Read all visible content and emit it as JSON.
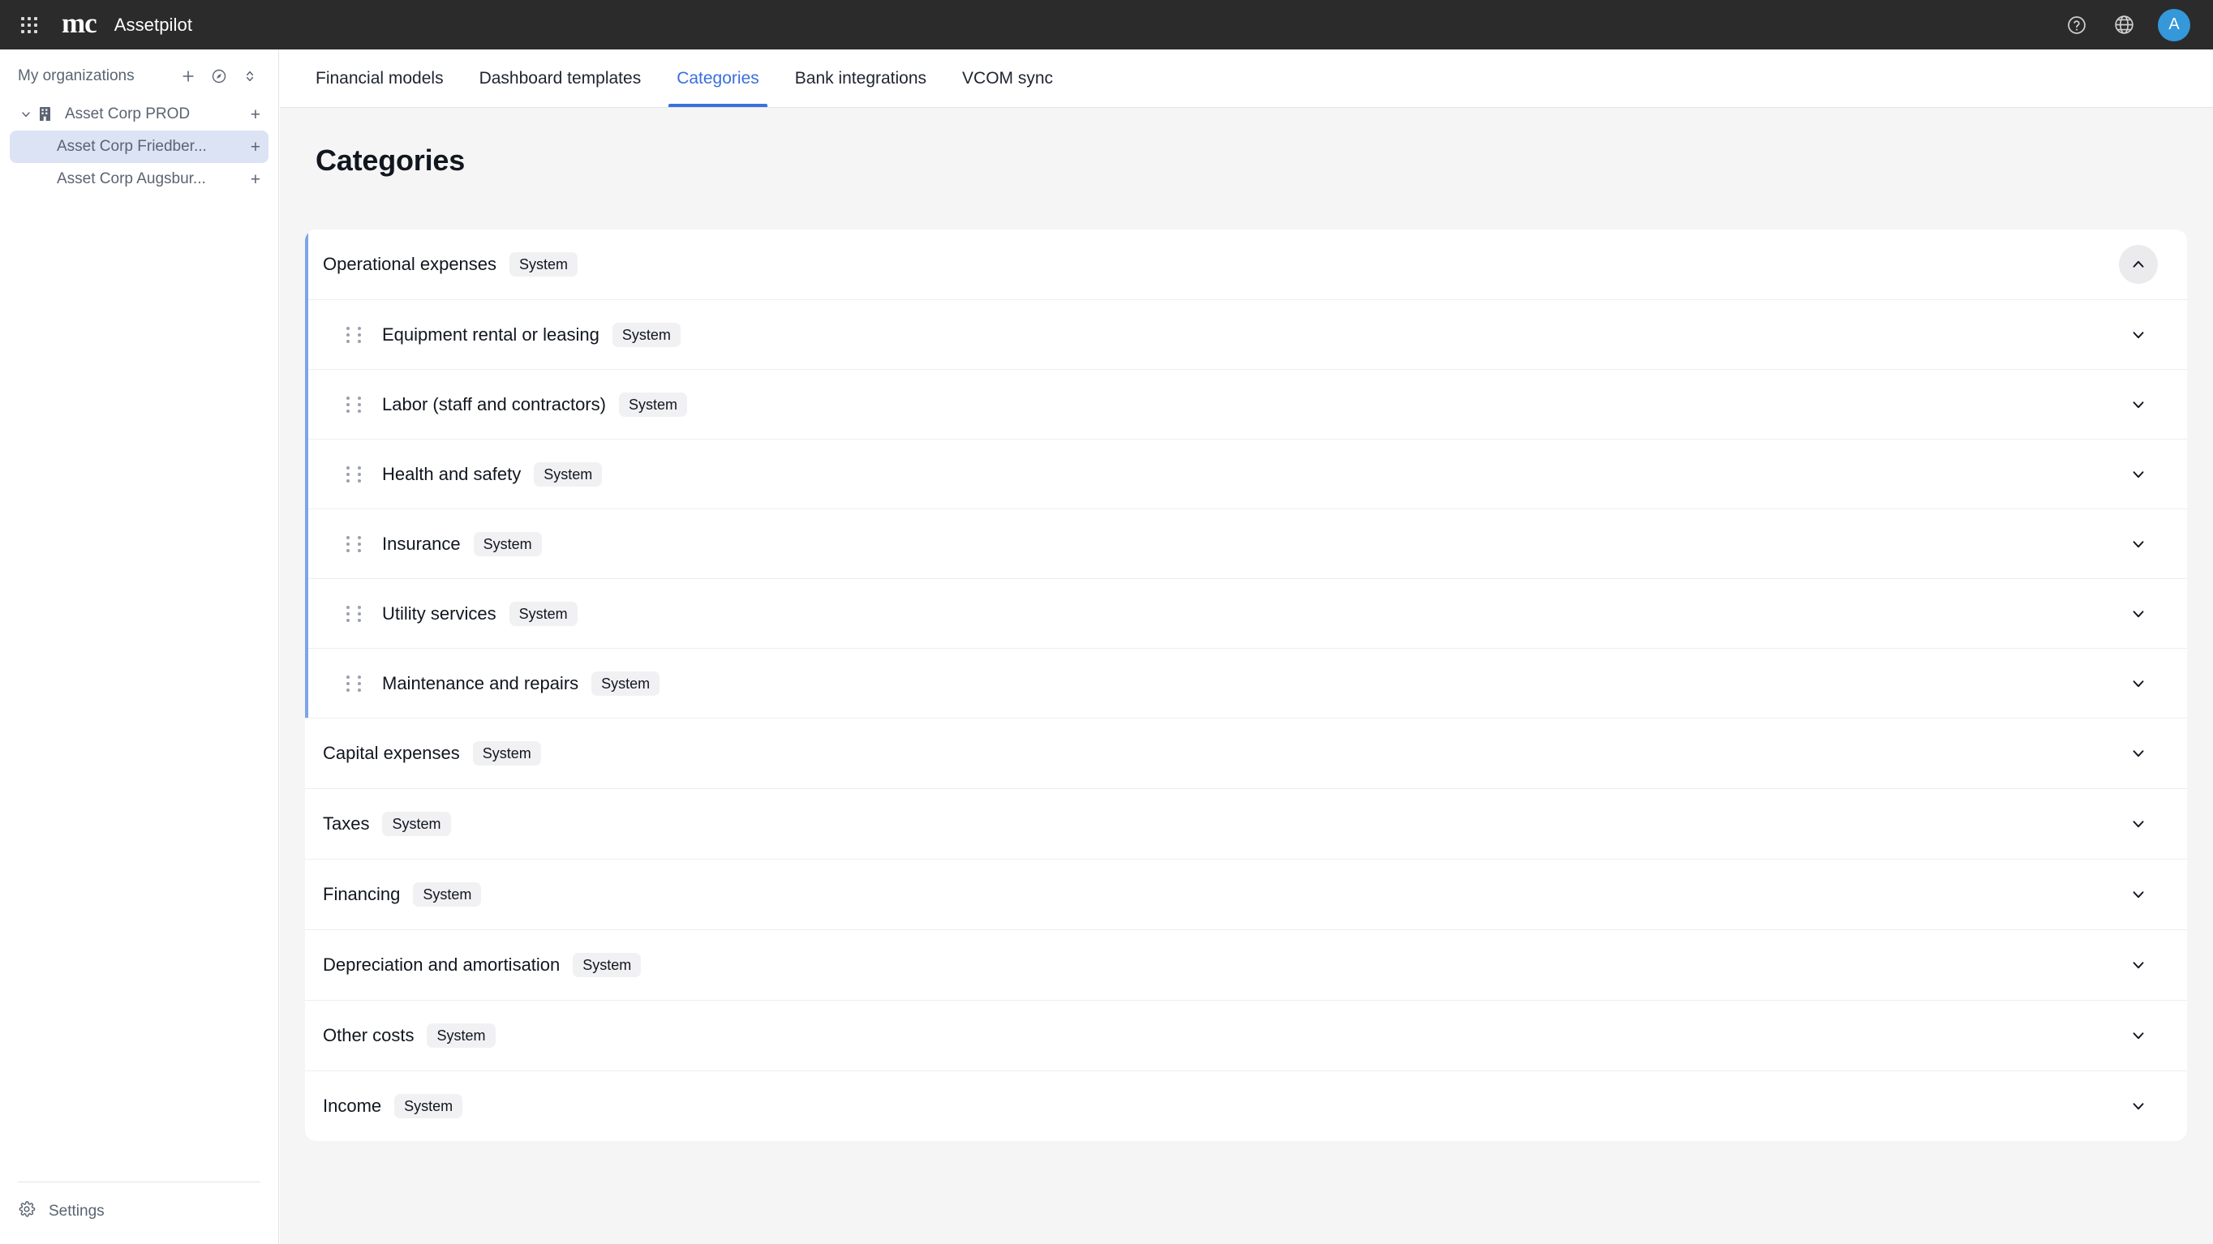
{
  "topbar": {
    "apps_icon": "apps-grid-icon",
    "logo_text": "mc",
    "brand": "Assetpilot",
    "help_icon": "help-circle-icon",
    "language_icon": "globe-icon",
    "avatar_initial": "A"
  },
  "sidebar": {
    "header": "My organizations",
    "add_icon": "plus-icon",
    "compass_icon": "compass-icon",
    "sort_icon": "chevron-up-down-icon",
    "items": [
      {
        "label": "Asset Corp PROD",
        "level": 0,
        "selected": false,
        "expanded": true,
        "has_building_icon": true,
        "plus": "+"
      },
      {
        "label": "Asset Corp Friedber...",
        "level": 1,
        "selected": true,
        "expanded": false,
        "has_building_icon": false,
        "plus": "+"
      },
      {
        "label": "Asset Corp Augsbur...",
        "level": 1,
        "selected": false,
        "expanded": false,
        "has_building_icon": false,
        "plus": "+"
      }
    ],
    "settings_label": "Settings",
    "settings_icon": "gear-icon"
  },
  "main": {
    "tabs": [
      {
        "label": "Financial models",
        "active": false
      },
      {
        "label": "Dashboard templates",
        "active": false
      },
      {
        "label": "Categories",
        "active": true
      },
      {
        "label": "Bank integrations",
        "active": false
      },
      {
        "label": "VCOM sync",
        "active": false
      }
    ],
    "page_title": "Categories",
    "badge_label": "System",
    "groups": [
      {
        "title": "Operational expenses",
        "badge": "System",
        "expanded": true,
        "chevron": "chevron-up-icon",
        "children": [
          {
            "title": "Equipment rental or leasing",
            "badge": "System",
            "chevron": "chevron-down-icon"
          },
          {
            "title": "Labor (staff and contractors)",
            "badge": "System",
            "chevron": "chevron-down-icon"
          },
          {
            "title": "Health and safety",
            "badge": "System",
            "chevron": "chevron-down-icon"
          },
          {
            "title": "Insurance",
            "badge": "System",
            "chevron": "chevron-down-icon"
          },
          {
            "title": "Utility services",
            "badge": "System",
            "chevron": "chevron-down-icon"
          },
          {
            "title": "Maintenance and repairs",
            "badge": "System",
            "chevron": "chevron-down-icon"
          }
        ]
      },
      {
        "title": "Capital expenses",
        "badge": "System",
        "expanded": false,
        "chevron": "chevron-down-icon",
        "children": []
      },
      {
        "title": "Taxes",
        "badge": "System",
        "expanded": false,
        "chevron": "chevron-down-icon",
        "children": []
      },
      {
        "title": "Financing",
        "badge": "System",
        "expanded": false,
        "chevron": "chevron-down-icon",
        "children": []
      },
      {
        "title": "Depreciation and amortisation",
        "badge": "System",
        "expanded": false,
        "chevron": "chevron-down-icon",
        "children": []
      },
      {
        "title": "Other costs",
        "badge": "System",
        "expanded": false,
        "chevron": "chevron-down-icon",
        "children": []
      },
      {
        "title": "Income",
        "badge": "System",
        "expanded": false,
        "chevron": "chevron-down-icon",
        "children": []
      }
    ]
  },
  "colors": {
    "topbar_bg": "#2b2b2b",
    "accent_blue": "#3b6fe0",
    "accent_border": "#7ea3e8",
    "selected_bg": "#dce3f5",
    "avatar_bg": "#3498db",
    "page_bg": "#f5f5f5",
    "badge_bg": "#f1f1f3"
  }
}
